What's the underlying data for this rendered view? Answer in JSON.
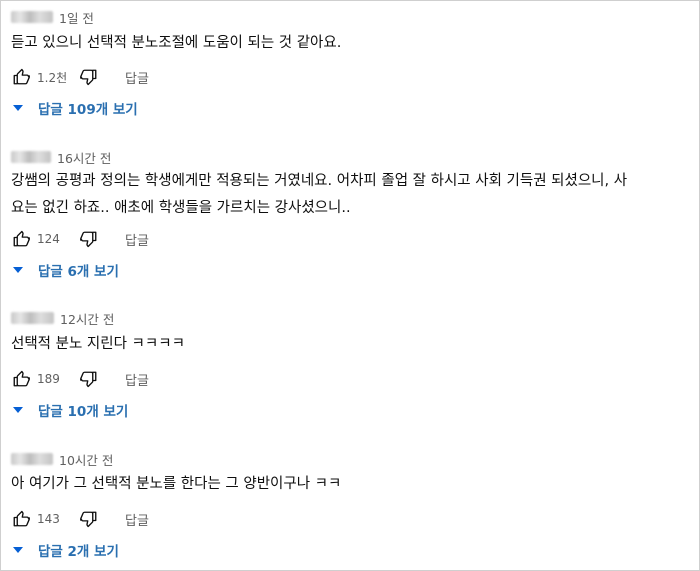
{
  "comments": [
    {
      "time": "1일 전",
      "text_lines": [
        "듣고 있으니 선택적 분노조절에 도움이 되는 것 같아요."
      ],
      "likes": "1.2천",
      "reply_label": "답글",
      "replies_label": "답글 109개 보기"
    },
    {
      "time": "16시간 전",
      "text_lines": [
        "강쌤의 공평과 정의는 학생에게만 적용되는 거였네요. 어차피 졸업 잘 하시고 사회 기득권 되셨으니, 사",
        "요는 없긴 하죠.. 애초에 학생들을 가르치는 강사셨으니.."
      ],
      "likes": "124",
      "reply_label": "답글",
      "replies_label": "답글 6개 보기"
    },
    {
      "time": "12시간 전",
      "text_lines": [
        "선택적 분노 지린다 ㅋㅋㅋㅋ"
      ],
      "likes": "189",
      "reply_label": "답글",
      "replies_label": "답글 10개 보기"
    },
    {
      "time": "10시간 전",
      "text_lines": [
        "아 여기가 그 선택적 분노를 한다는 그 양반이구나 ㅋㅋ"
      ],
      "likes": "143",
      "reply_label": "답글",
      "replies_label": "답글 2개 보기"
    }
  ],
  "icons": {
    "like": "thumbs-up-icon",
    "dislike": "thumbs-down-icon",
    "expand": "caret-down-icon"
  },
  "colors": {
    "text": "#0f0f0f",
    "secondary": "#606060",
    "link_blue": "#2a6fb0"
  }
}
